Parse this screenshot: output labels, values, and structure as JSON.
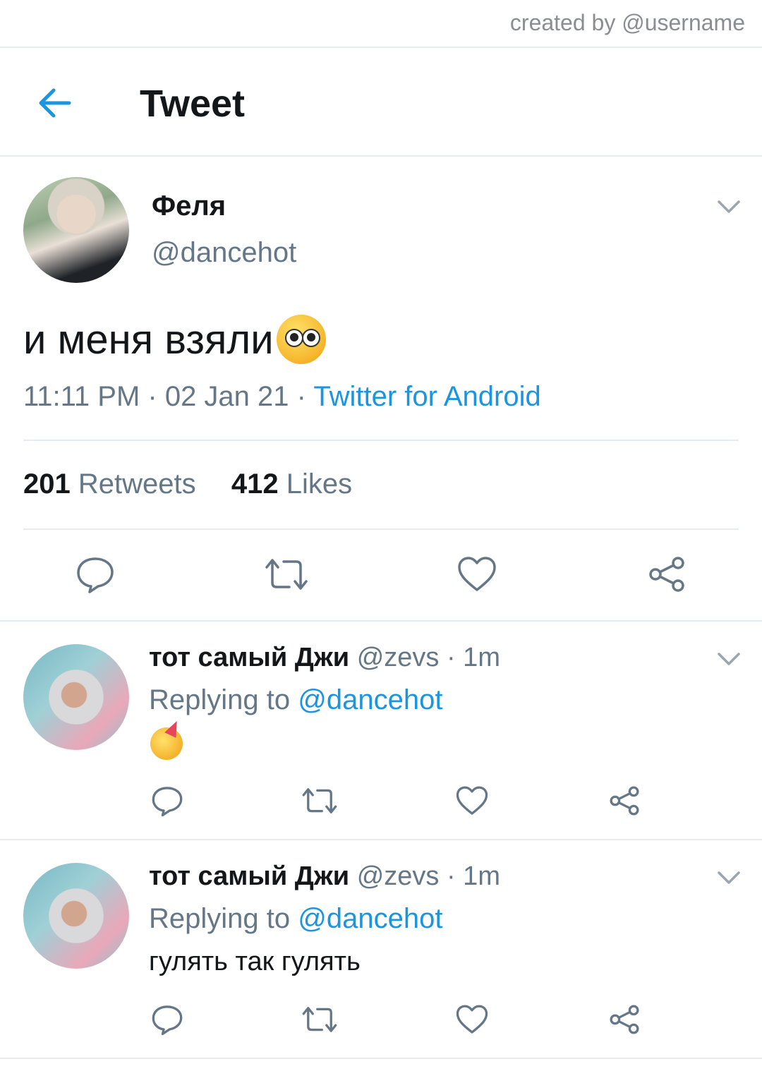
{
  "credit": "created by @username",
  "header": {
    "title": "Tweet"
  },
  "tweet": {
    "name": "Феля",
    "handle": "@dancehot",
    "text": "и меня взяли",
    "time": "11:11 PM · 02 Jan 21 · ",
    "source": "Twitter for Android",
    "retweets_count": "201",
    "retweets_label": "Retweets",
    "likes_count": "412",
    "likes_label": "Likes",
    "text_emoji_icon": "pleading-face-icon"
  },
  "replies": [
    {
      "name": "тот самый Джи",
      "handle_time": "@zevs · 1m",
      "replying_label": "Replying to ",
      "replying_to": "@dancehot",
      "text": "",
      "emoji_icon": "partying-face-icon"
    },
    {
      "name": "тот самый Джи",
      "handle_time": "@zevs · 1m",
      "replying_label": "Replying to ",
      "replying_to": "@dancehot",
      "text": "гулять так гулять"
    }
  ],
  "colors": {
    "accent": "#1b95e0",
    "muted": "#657786",
    "divider": "#e6ecf0",
    "icon": "#657786"
  }
}
